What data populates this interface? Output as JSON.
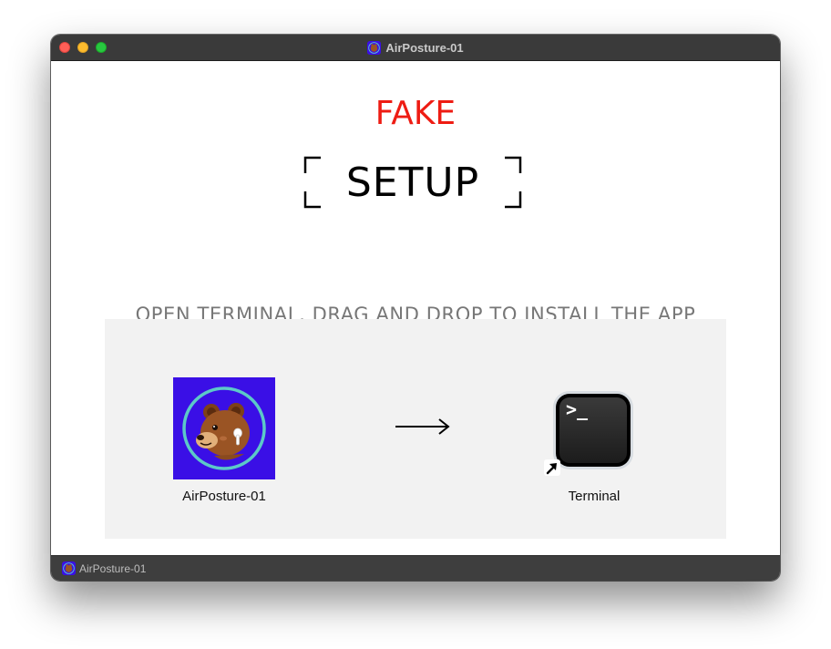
{
  "window": {
    "title": "AirPosture-01",
    "app_icon": "bear-airpods-icon"
  },
  "header": {
    "fake_label": "FAKE",
    "setup_title": "SETUP"
  },
  "instructions": "OPEN TERMINAL, DRAG AND DROP TO INSTALL THE APP",
  "drop_area": {
    "source": {
      "label": "AirPosture-01",
      "icon": "bear-airpods-icon"
    },
    "arrow": "right-arrow-icon",
    "target": {
      "label": "Terminal",
      "icon": "terminal-icon",
      "prompt": ">_",
      "badge": "alias-arrow-icon"
    }
  },
  "statusbar": {
    "label": "AirPosture-01",
    "icon": "bear-airpods-icon"
  },
  "colors": {
    "fake_label": "#ee1c13",
    "app_icon_background": "#3a0fe6",
    "app_icon_ring": "#5cc9c8",
    "bear_fur": "#9a5424",
    "titlebar": "#3a3a3a",
    "drop_area": "#f2f2f2",
    "instructions_text": "#777777"
  }
}
